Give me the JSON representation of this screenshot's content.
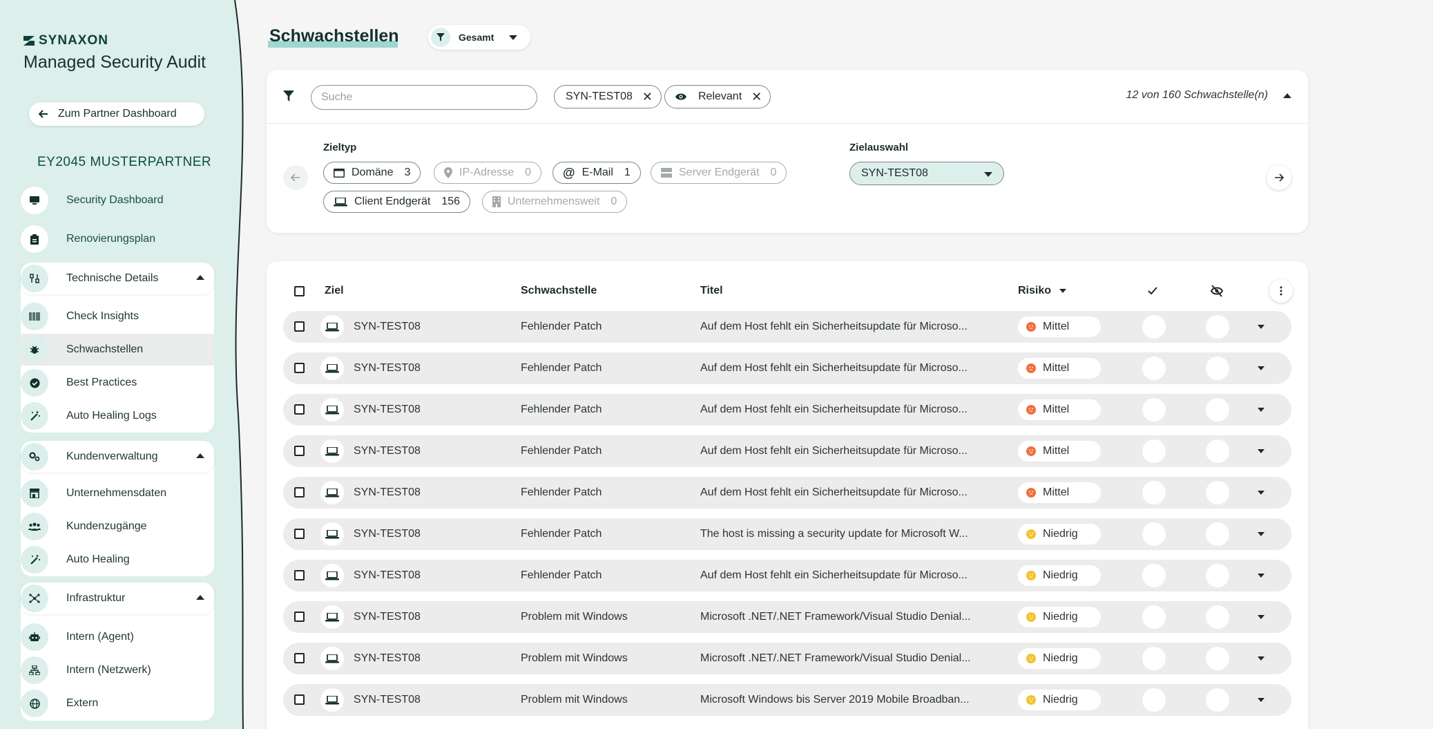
{
  "brand": {
    "name": "SYNAXON",
    "title": "Managed Security Audit"
  },
  "sidebar": {
    "partner_button": "Zum Partner Dashboard",
    "partner_name": "EY2045 MUSTERPARTNER",
    "top_items": [
      {
        "label": "Security Dashboard",
        "icon": "monitor-icon"
      },
      {
        "label": "Renovierungsplan",
        "icon": "clipboard-icon"
      }
    ],
    "groups": [
      {
        "label": "Technische Details",
        "icon": "sliders-icon",
        "items": [
          {
            "label": "Check Insights",
            "icon": "barcode-icon"
          },
          {
            "label": "Schwachstellen",
            "icon": "bug-icon",
            "active": true
          },
          {
            "label": "Best Practices",
            "icon": "check-badge-icon"
          },
          {
            "label": "Auto Healing Logs",
            "icon": "magic-wand-icon"
          }
        ]
      },
      {
        "label": "Kundenverwaltung",
        "icon": "gears-icon",
        "items": [
          {
            "label": "Unternehmensdaten",
            "icon": "store-icon"
          },
          {
            "label": "Kundenzugänge",
            "icon": "users-icon"
          },
          {
            "label": "Auto Healing",
            "icon": "magic-wand-icon"
          }
        ]
      },
      {
        "label": "Infrastruktur",
        "icon": "network-icon",
        "items": [
          {
            "label": "Intern (Agent)",
            "icon": "robot-icon"
          },
          {
            "label": "Intern (Netzwerk)",
            "icon": "sitemap-icon"
          },
          {
            "label": "Extern",
            "icon": "globe-icon"
          }
        ]
      }
    ]
  },
  "main": {
    "title": "Schwachstellen",
    "scope_select": "Gesamt",
    "filter": {
      "search_placeholder": "Suche",
      "chip_target": "SYN-TEST08",
      "chip_relevant": "Relevant",
      "counter": "12 von 160 Schwachstelle(n)",
      "zieltyp_label": "Zieltyp",
      "zielauswahl_label": "Zielauswahl",
      "zielauswahl_value": "SYN-TEST08",
      "types": [
        {
          "label": "Domäne",
          "count": "3",
          "icon": "browser-window-icon",
          "enabled": true
        },
        {
          "label": "IP-Adresse",
          "count": "0",
          "icon": "map-pin-icon",
          "enabled": false
        },
        {
          "label": "E-Mail",
          "count": "1",
          "icon": "at-sign-icon",
          "enabled": true
        },
        {
          "label": "Server Endgerät",
          "count": "0",
          "icon": "server-icon",
          "enabled": false
        },
        {
          "label": "Client Endgerät",
          "count": "156",
          "icon": "laptop-icon",
          "enabled": true
        },
        {
          "label": "Unternehmensweit",
          "count": "0",
          "icon": "building-icon",
          "enabled": false
        }
      ]
    },
    "table": {
      "headers": {
        "target": "Ziel",
        "vuln": "Schwachstelle",
        "title": "Titel",
        "risk": "Risiko"
      },
      "rows": [
        {
          "target": "SYN-TEST08",
          "vuln": "Fehlender Patch",
          "title": "Auf dem Host fehlt ein Sicherheitsupdate für Microso...",
          "risk": "Mittel",
          "level": "medium"
        },
        {
          "target": "SYN-TEST08",
          "vuln": "Fehlender Patch",
          "title": "Auf dem Host fehlt ein Sicherheitsupdate für Microso...",
          "risk": "Mittel",
          "level": "medium"
        },
        {
          "target": "SYN-TEST08",
          "vuln": "Fehlender Patch",
          "title": "Auf dem Host fehlt ein Sicherheitsupdate für Microso...",
          "risk": "Mittel",
          "level": "medium"
        },
        {
          "target": "SYN-TEST08",
          "vuln": "Fehlender Patch",
          "title": "Auf dem Host fehlt ein Sicherheitsupdate für Microso...",
          "risk": "Mittel",
          "level": "medium"
        },
        {
          "target": "SYN-TEST08",
          "vuln": "Fehlender Patch",
          "title": "Auf dem Host fehlt ein Sicherheitsupdate für Microso...",
          "risk": "Mittel",
          "level": "medium"
        },
        {
          "target": "SYN-TEST08",
          "vuln": "Fehlender Patch",
          "title": "The host is missing a security update for Microsoft W...",
          "risk": "Niedrig",
          "level": "low"
        },
        {
          "target": "SYN-TEST08",
          "vuln": "Fehlender Patch",
          "title": "Auf dem Host fehlt ein Sicherheitsupdate für Microso...",
          "risk": "Niedrig",
          "level": "low"
        },
        {
          "target": "SYN-TEST08",
          "vuln": "Problem mit Windows",
          "title": "Microsoft .NET/.NET Framework/Visual Studio Denial...",
          "risk": "Niedrig",
          "level": "low"
        },
        {
          "target": "SYN-TEST08",
          "vuln": "Problem mit Windows",
          "title": "Microsoft .NET/.NET Framework/Visual Studio Denial...",
          "risk": "Niedrig",
          "level": "low"
        },
        {
          "target": "SYN-TEST08",
          "vuln": "Problem mit Windows",
          "title": "Microsoft Windows bis Server 2019 Mobile Broadban...",
          "risk": "Niedrig",
          "level": "low"
        }
      ]
    }
  },
  "colors": {
    "accent": "#9fd6cf",
    "sidebar_bg": "#dcefea",
    "medium": "#f0703e",
    "low": "#f2c230"
  }
}
